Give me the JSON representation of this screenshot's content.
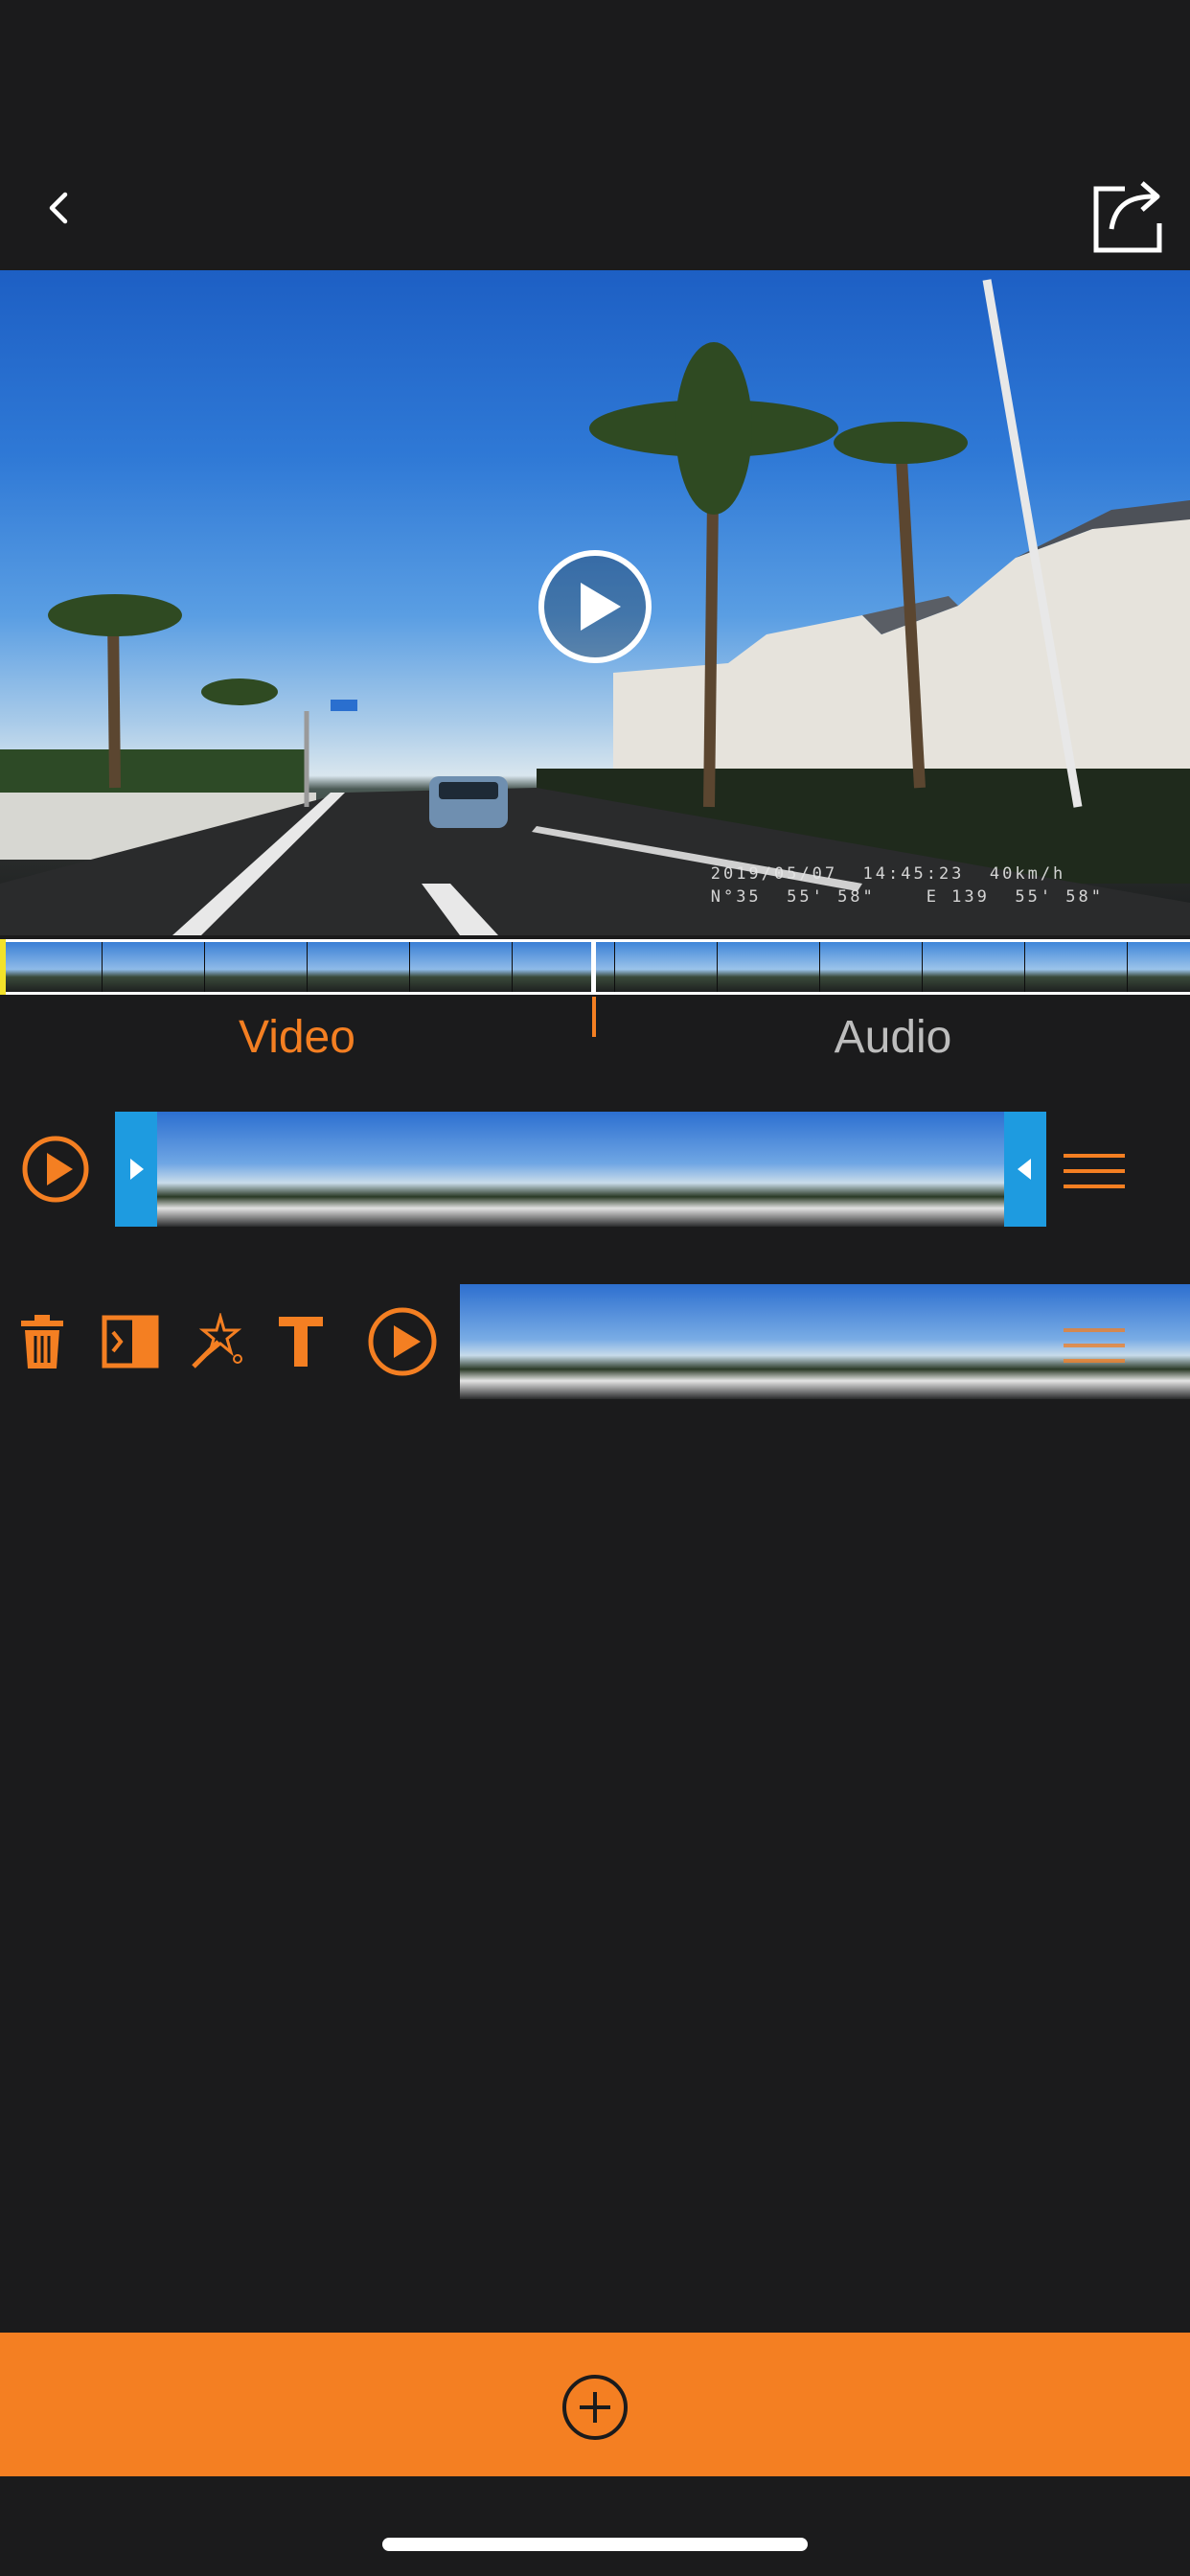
{
  "header": {
    "back_icon": "chevron-left-icon",
    "share_icon": "share-icon"
  },
  "preview": {
    "osd_line1": "2019/05/07  14:45:23  40km/h",
    "osd_line2": "N°35  55' 58\"    E 139  55' 58\"",
    "play_icon": "play-circle-icon"
  },
  "tabs": [
    {
      "label": "Video",
      "active": true
    },
    {
      "label": "Audio",
      "active": false
    }
  ],
  "colors": {
    "accent": "#f47f22",
    "trim_handle": "#1e9be0",
    "background": "#1b1b1c",
    "filmstrip_start_marker": "#f3e22a"
  },
  "clip_row": {
    "play_icon": "play-circle-icon",
    "menu_icon": "menu-lines-icon"
  },
  "tools": [
    {
      "name": "delete",
      "icon": "trash-icon"
    },
    {
      "name": "split",
      "icon": "split-icon"
    },
    {
      "name": "effects",
      "icon": "magic-wand-icon"
    },
    {
      "name": "text",
      "icon": "text-icon"
    },
    {
      "name": "play",
      "icon": "play-circle-icon"
    }
  ],
  "bottom_bar": {
    "add_icon": "plus-circle-icon"
  }
}
